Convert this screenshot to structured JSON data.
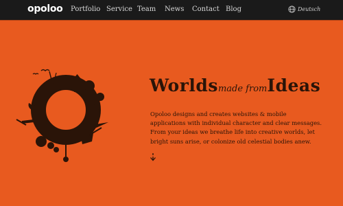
{
  "header": {
    "logo": "opoloo",
    "nav": [
      {
        "label": "Portfolio"
      },
      {
        "label": "Service"
      },
      {
        "label": "Team"
      },
      {
        "label": "News"
      },
      {
        "label": "Contact"
      },
      {
        "label": "Blog"
      }
    ],
    "language": {
      "label": "Deutsch",
      "icon": "globe-icon"
    }
  },
  "hero": {
    "headline_part1": "Worlds",
    "headline_part2": "made from",
    "headline_part3": "Ideas",
    "paragraph": "Opoloo designs and creates websites & mobile applications with individual character and clear messages. From your ideas we breathe life into creative worlds, let bright suns arise, or colonize old celestial bodies anew.",
    "scroll_icon": "arrow-down-icon"
  },
  "colors": {
    "background": "#e85a1f",
    "topbar": "#1a1a1a",
    "text_dark": "#2a1408",
    "nav_text": "#d8d8d8"
  }
}
